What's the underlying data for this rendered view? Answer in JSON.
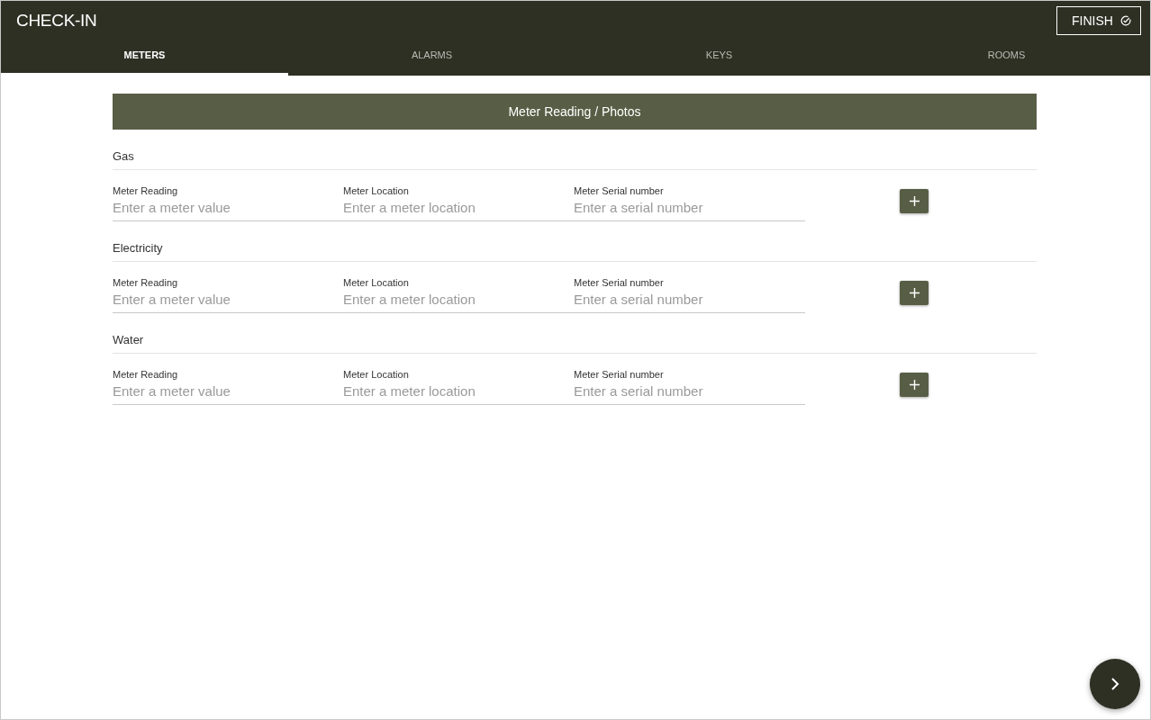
{
  "header": {
    "title": "CHECK-IN",
    "finish_button": "FINISH"
  },
  "tabs": [
    {
      "label": "METERS",
      "selected": true
    },
    {
      "label": "ALARMS",
      "selected": false
    },
    {
      "label": "KEYS",
      "selected": false
    },
    {
      "label": "ROOMS",
      "selected": false
    }
  ],
  "banner": "Meter Reading / Photos",
  "meters": [
    {
      "name": "Gas",
      "fields": [
        {
          "label": "Meter Reading",
          "placeholder": "Enter a meter value"
        },
        {
          "label": "Meter Location",
          "placeholder": "Enter a meter location"
        },
        {
          "label": "Meter Serial number",
          "placeholder": "Enter a serial number"
        }
      ]
    },
    {
      "name": "Electricity",
      "fields": [
        {
          "label": "Meter Reading",
          "placeholder": "Enter a meter value"
        },
        {
          "label": "Meter Location",
          "placeholder": "Enter a meter location"
        },
        {
          "label": "Meter Serial number",
          "placeholder": "Enter a serial number"
        }
      ]
    },
    {
      "name": "Water",
      "fields": [
        {
          "label": "Meter Reading",
          "placeholder": "Enter a meter value"
        },
        {
          "label": "Meter Location",
          "placeholder": "Enter a meter location"
        },
        {
          "label": "Meter Serial number",
          "placeholder": "Enter a serial number"
        }
      ]
    }
  ]
}
